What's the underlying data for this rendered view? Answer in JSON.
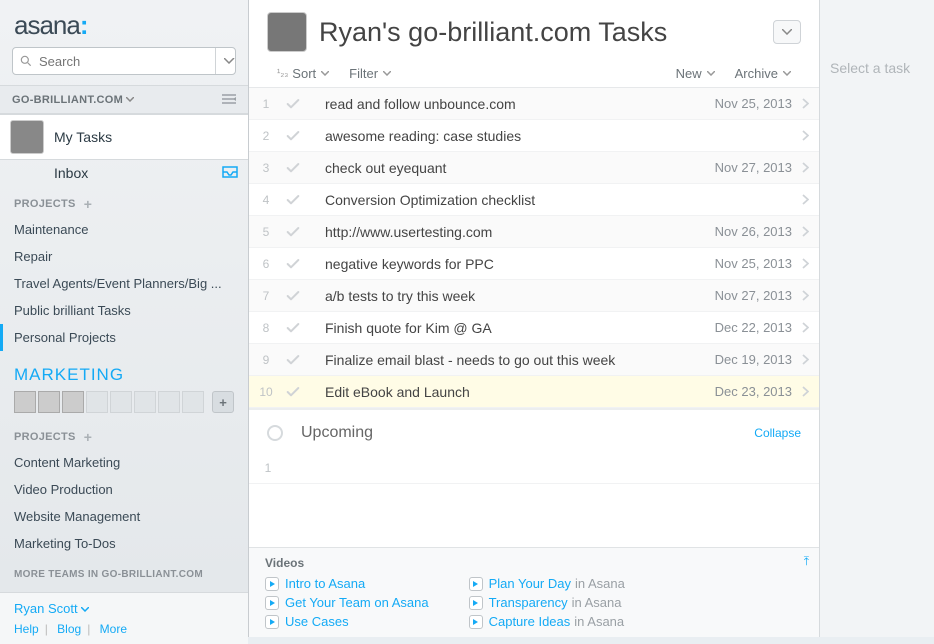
{
  "brand": "asana",
  "search": {
    "placeholder": "Search"
  },
  "workspace": {
    "name": "GO-BRILLIANT.COM"
  },
  "nav": {
    "myTasks": "My Tasks",
    "inbox": "Inbox"
  },
  "sectionProjects": "PROJECTS",
  "projects1": [
    "Maintenance",
    "Repair",
    "Travel Agents/Event Planners/Big ...",
    "Public brilliant Tasks",
    "Personal Projects"
  ],
  "team": {
    "name": "MARKETING"
  },
  "projects2": [
    "Content Marketing",
    "Video Production",
    "Website Management",
    "Marketing To-Dos"
  ],
  "moreTeams": "MORE TEAMS IN GO-BRILLIANT.COM",
  "user": {
    "name": "Ryan Scott"
  },
  "footerLinks": {
    "help": "Help",
    "blog": "Blog",
    "more": "More"
  },
  "header": {
    "title": "Ryan's go-brilliant.com Tasks"
  },
  "toolbar": {
    "sort": "Sort",
    "filter": "Filter",
    "new": "New",
    "archive": "Archive"
  },
  "tasks": [
    {
      "n": 1,
      "title": "read and follow unbounce.com",
      "date": "Nov 25, 2013"
    },
    {
      "n": 2,
      "title": "awesome reading: case studies",
      "date": ""
    },
    {
      "n": 3,
      "title": "check out eyequant",
      "date": "Nov 27, 2013"
    },
    {
      "n": 4,
      "title": "Conversion Optimization checklist",
      "date": ""
    },
    {
      "n": 5,
      "title": "http://www.usertesting.com",
      "date": "Nov 26, 2013"
    },
    {
      "n": 6,
      "title": "negative keywords for PPC",
      "date": "Nov 25, 2013"
    },
    {
      "n": 7,
      "title": "a/b tests to try this week",
      "date": "Nov 27, 2013"
    },
    {
      "n": 8,
      "title": "Finish quote for Kim @ GA",
      "date": "Dec 22, 2013"
    },
    {
      "n": 9,
      "title": "Finalize email blast - needs to go out this week",
      "date": "Dec 19, 2013"
    },
    {
      "n": 10,
      "title": "Edit eBook and Launch",
      "date": "Dec 23, 2013"
    }
  ],
  "upcoming": {
    "label": "Upcoming",
    "collapse": "Collapse"
  },
  "videos": {
    "header": "Videos",
    "col1": [
      {
        "t": "Intro to Asana",
        "s": ""
      },
      {
        "t": "Get Your Team on Asana",
        "s": ""
      },
      {
        "t": "Use Cases",
        "s": ""
      }
    ],
    "col2": [
      {
        "t": "Plan Your Day",
        "s": "in Asana"
      },
      {
        "t": "Transparency",
        "s": "in Asana"
      },
      {
        "t": "Capture Ideas",
        "s": "in Asana"
      }
    ]
  },
  "rightPane": {
    "placeholder": "Select a task"
  }
}
